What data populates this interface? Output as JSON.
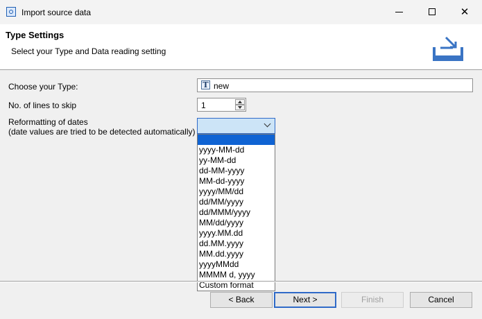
{
  "window": {
    "title": "Import source data",
    "close_glyph": "✕",
    "icons": [
      "app-icon",
      "minimize-icon",
      "maximize-icon",
      "close-icon"
    ]
  },
  "header": {
    "title": "Type Settings",
    "subtitle": "Select your Type and Data reading setting",
    "icon": "import-tray-icon"
  },
  "form": {
    "type_label": "Choose your Type:",
    "type_icon_glyph": "T",
    "type_value": "new",
    "skip_label": "No. of lines to skip",
    "skip_value": "1",
    "dates_label": "Reformatting of dates",
    "dates_hint": "(date values are tried to be detected automatically)",
    "dates_value": "",
    "date_options": [
      "yyyy-MM-dd",
      "yy-MM-dd",
      "dd-MM-yyyy",
      "MM-dd-yyyy",
      "yyyy/MM/dd",
      "dd/MM/yyyy",
      "dd/MMM/yyyy",
      "MM/dd/yyyy",
      "yyyy.MM.dd",
      "dd.MM.yyyy",
      "MM.dd.yyyy",
      "yyyyMMdd",
      "MMMM d, yyyy",
      "Custom format"
    ]
  },
  "buttons": {
    "back": "< Back",
    "next": "Next >",
    "finish": "Finish",
    "cancel": "Cancel"
  },
  "colors": {
    "accent": "#2f6ac8",
    "selection": "#0f63d3",
    "combo_bg": "#cce4f7",
    "disabled_text": "#a0a0a0"
  }
}
